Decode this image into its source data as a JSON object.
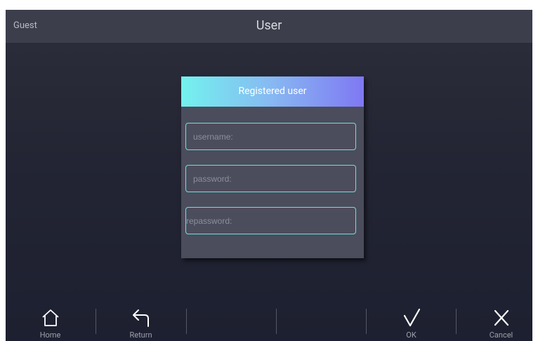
{
  "header": {
    "user": "Guest",
    "title": "User"
  },
  "dialog": {
    "title": "Registered user",
    "fields": [
      {
        "placeholder": "username:",
        "value": ""
      },
      {
        "placeholder": "password:",
        "value": ""
      },
      {
        "placeholder": "repassword:",
        "value": ""
      }
    ]
  },
  "nav": {
    "home": {
      "label": "Home",
      "icon": "home-icon"
    },
    "return": {
      "label": "Return",
      "icon": "return-arrow-icon"
    },
    "ok": {
      "label": "OK",
      "icon": "check-icon"
    },
    "cancel": {
      "label": "Cancel",
      "icon": "close-icon"
    }
  },
  "colors": {
    "background": "#232534",
    "topbar": "#3c3e4b",
    "dialog": "#4b4d5c",
    "field_border": "#6fe1dc",
    "header_gradient_start": "#73f2ee",
    "header_gradient_end": "#7f78f3"
  }
}
